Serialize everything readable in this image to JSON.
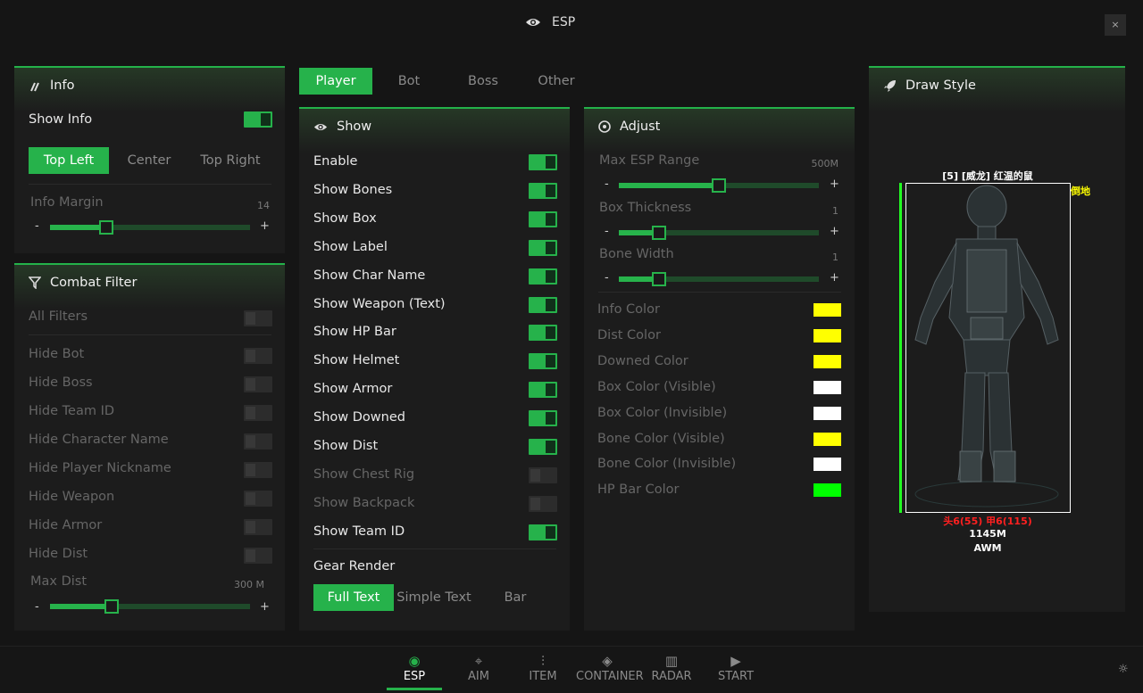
{
  "window": {
    "title": "ESP",
    "close_label": "×"
  },
  "info_panel": {
    "title": "Info",
    "show_info_label": "Show Info",
    "position_tabs": [
      "Top Left",
      "Center",
      "Top Right"
    ],
    "margin_label": "Info Margin",
    "margin_value": "14",
    "margin_fraction": 0.28
  },
  "combat_panel": {
    "title": "Combat Filter",
    "items": [
      "All Filters",
      "Hide Bot",
      "Hide Boss",
      "Hide Team ID",
      "Hide Character Name",
      "Hide Player Nickname",
      "Hide Weapon",
      "Hide Armor",
      "Hide Dist"
    ],
    "max_dist_label": "Max Dist",
    "max_dist_value": "300 M",
    "max_dist_fraction": 0.31
  },
  "entity_tabs": [
    "Player",
    "Bot",
    "Boss",
    "Other"
  ],
  "show_panel": {
    "title": "Show",
    "items": [
      {
        "label": "Enable",
        "on": true
      },
      {
        "label": "Show Bones",
        "on": true
      },
      {
        "label": "Show Box",
        "on": true
      },
      {
        "label": "Show Label",
        "on": true
      },
      {
        "label": "Show Char Name",
        "on": true
      },
      {
        "label": "Show Weapon (Text)",
        "on": true
      },
      {
        "label": "Show HP Bar",
        "on": true
      },
      {
        "label": "Show Helmet",
        "on": true
      },
      {
        "label": "Show Armor",
        "on": true
      },
      {
        "label": "Show Downed",
        "on": true
      },
      {
        "label": "Show Dist",
        "on": true
      },
      {
        "label": "Show Chest Rig",
        "on": false
      },
      {
        "label": "Show Backpack",
        "on": false
      },
      {
        "label": "Show Team ID",
        "on": true
      }
    ],
    "gear_render_label": "Gear Render",
    "gear_tabs": [
      "Full Text",
      "Simple Text",
      "Bar"
    ]
  },
  "adjust_panel": {
    "title": "Adjust",
    "sliders": [
      {
        "label": "Max ESP Range",
        "value": "500M",
        "fraction": 0.5
      },
      {
        "label": "Box Thickness",
        "value": "1",
        "fraction": 0.2
      },
      {
        "label": "Bone Width",
        "value": "1",
        "fraction": 0.2
      }
    ],
    "colors": [
      {
        "label": "Info Color",
        "color": "#ffff00"
      },
      {
        "label": "Dist Color",
        "color": "#ffff00"
      },
      {
        "label": "Downed Color",
        "color": "#ffff00"
      },
      {
        "label": "Box Color (Visible)",
        "color": "#ffffff"
      },
      {
        "label": "Box Color (Invisible)",
        "color": "#ffffff"
      },
      {
        "label": "Bone Color (Visible)",
        "color": "#ffff00"
      },
      {
        "label": "Bone Color (Invisible)",
        "color": "#ffffff"
      },
      {
        "label": "HP Bar Color",
        "color": "#00ff00"
      }
    ]
  },
  "draw_panel": {
    "title": "Draw Style",
    "name_label": "[5] [威龙] 红温的鼠",
    "downed_label": "倒地",
    "gear_label": "头6(55) 甲6(115)",
    "dist_label": "1145M",
    "weapon_label": "AWM"
  },
  "nav": [
    {
      "label": "ESP",
      "icon": "eye-icon"
    },
    {
      "label": "AIM",
      "icon": "crosshair-icon"
    },
    {
      "label": "ITEM",
      "icon": "sliders-icon"
    },
    {
      "label": "CONTAINER",
      "icon": "box-icon"
    },
    {
      "label": "RADAR",
      "icon": "map-icon"
    },
    {
      "label": "START",
      "icon": "play-icon"
    }
  ],
  "accent": "#26b24b"
}
